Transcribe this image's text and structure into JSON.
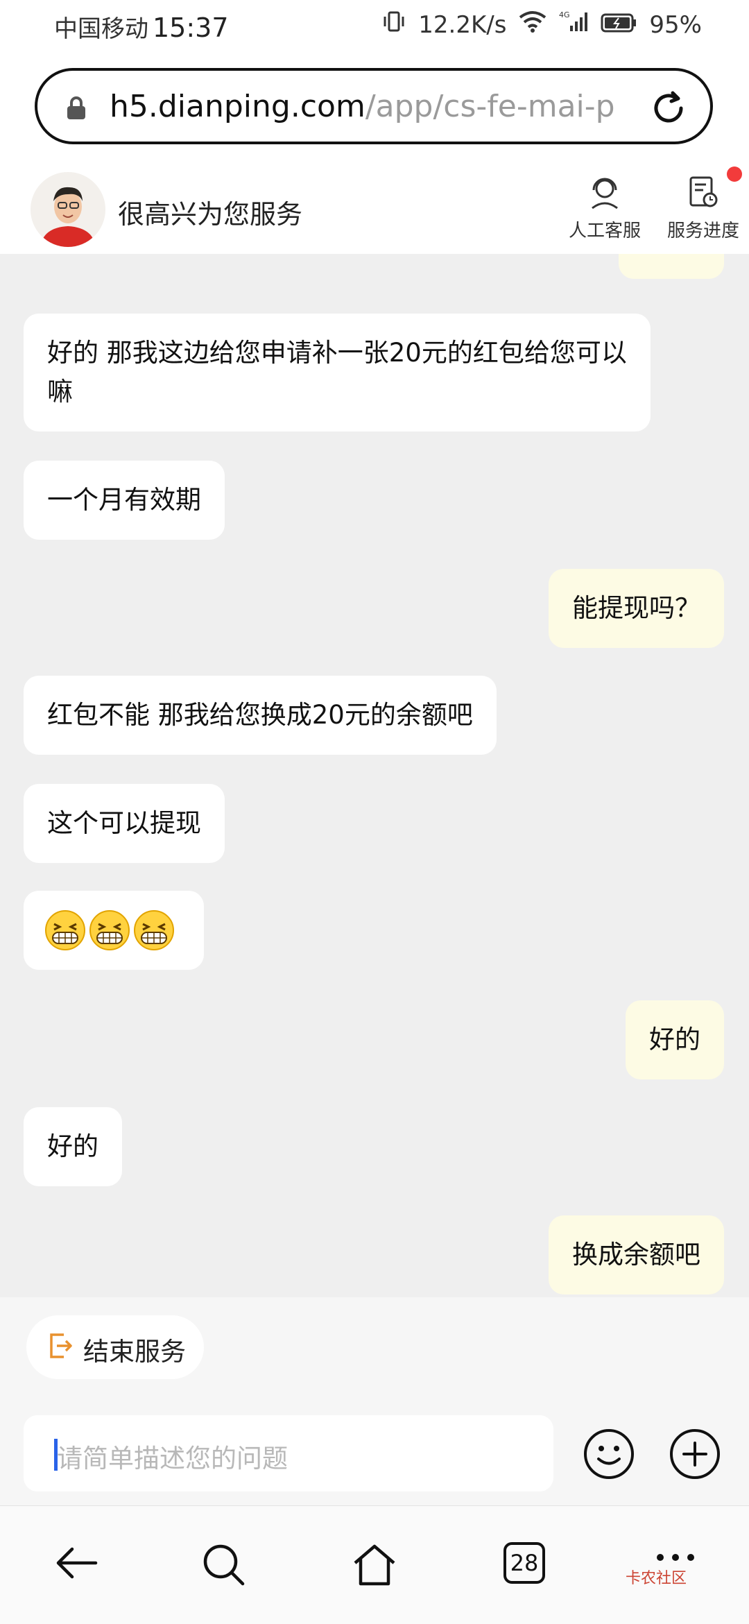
{
  "status_bar": {
    "carrier": "中国移动",
    "time": "15:37",
    "net_speed": "12.2K/s",
    "network": "4G",
    "battery": "95%"
  },
  "browser": {
    "url_host": "h5.dianping.com",
    "url_path": "/app/cs-fe-mai-p",
    "lock_icon": "lock-icon",
    "reload_icon": "reload-icon"
  },
  "header": {
    "title": "很高兴为您服务",
    "human_service": "人工客服",
    "service_progress": "服务进度",
    "badge_color": "#f23b3b"
  },
  "messages": [
    {
      "side": "left",
      "text": "好的 那我这边给您申请补一张20元的红包给您可以嘛"
    },
    {
      "side": "left",
      "text": "一个月有效期"
    },
    {
      "side": "right",
      "text": "能提现吗？"
    },
    {
      "side": "left",
      "text": "红包不能 那我给您换成20元的余额吧"
    },
    {
      "side": "left",
      "text": "这个可以提现"
    },
    {
      "side": "left",
      "text": "grin-emoji x3"
    },
    {
      "side": "right",
      "text": "好的"
    },
    {
      "side": "left",
      "text": "好的"
    },
    {
      "side": "right",
      "text": "换成余额吧"
    }
  ],
  "footer": {
    "end_service": "结束服务",
    "input_placeholder": "请简单描述您的问题"
  },
  "nav": {
    "tab_count": "28"
  },
  "watermark": "卡农社区",
  "colors": {
    "left_bubble": "#ffffff",
    "right_bubble": "#fdfbe4",
    "chat_bg": "#efefef",
    "accent_orange": "#e8912e"
  }
}
